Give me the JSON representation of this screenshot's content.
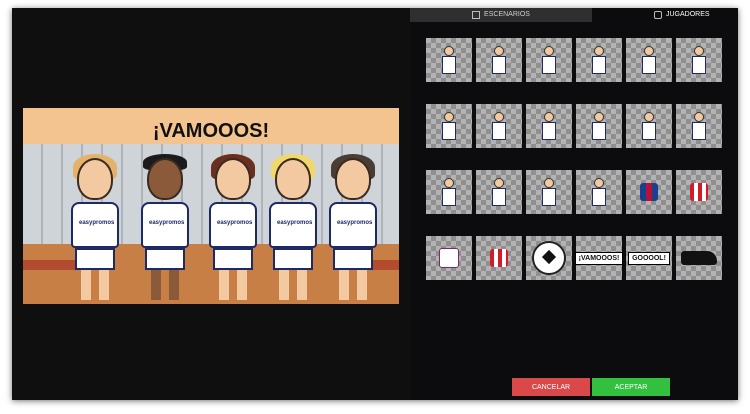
{
  "tabs": {
    "escenarios": {
      "label": "ESCENARIOS",
      "icon": "scene-icon"
    },
    "jugadores": {
      "label": "JUGADORES",
      "icon": "shirt-icon"
    }
  },
  "canvas": {
    "title_text": "¡VAMOOOS!",
    "players": [
      {
        "name": "player-blonde-woman",
        "hair": "#e4b26a",
        "logo": "easypromos"
      },
      {
        "name": "player-dark-man",
        "hair": "#1b1b1b",
        "logo": "easypromos"
      },
      {
        "name": "player-brunette-woman",
        "hair": "#6a2f1f",
        "logo": "easypromos"
      },
      {
        "name": "player-blonde-short",
        "hair": "#f1d86a",
        "logo": "easypromos"
      },
      {
        "name": "player-bearded-man",
        "hair": "#4a3d33",
        "logo": "easypromos"
      }
    ]
  },
  "library": {
    "rows": [
      [
        "player-1",
        "player-2",
        "player-3",
        "player-4",
        "player-5",
        "player-6"
      ],
      [
        "player-7",
        "player-8",
        "player-9",
        "player-10",
        "player-11",
        "player-12"
      ],
      [
        "player-13",
        "player-14",
        "player-15",
        "player-16",
        "jersey-barcelona",
        "jersey-atletico"
      ],
      [
        "jersey-white",
        "jersey-redwhite",
        "soccer-ball",
        "sticker-vamooos",
        "sticker-goooal",
        "soccer-boot"
      ]
    ],
    "stickers": {
      "vamooos": "¡VAMOOOS!",
      "gooool": "GOOOOL!"
    }
  },
  "buttons": {
    "cancel": "CANCELAR",
    "accept": "ACEPTAR"
  },
  "colors": {
    "cancel": "#d9494a",
    "accept": "#33c03f",
    "background": "#0c0c0e"
  }
}
